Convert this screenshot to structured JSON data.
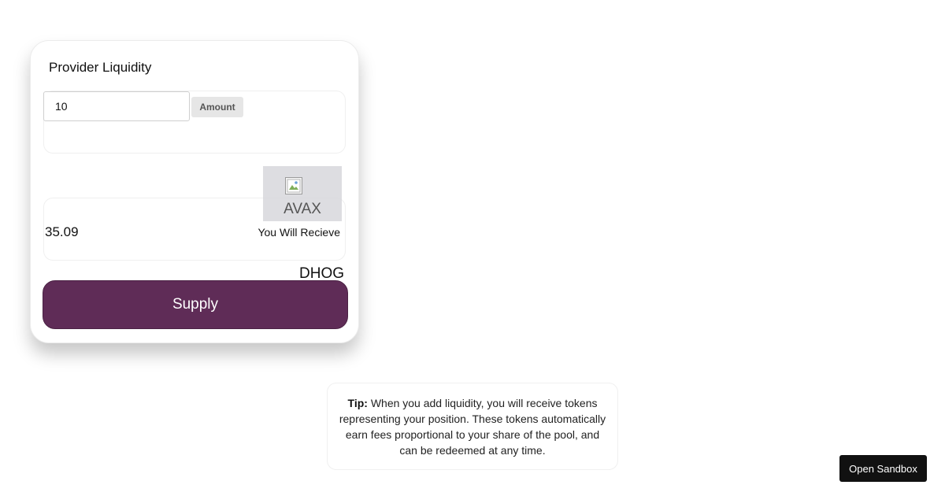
{
  "card": {
    "title": "Provider Liquidity",
    "input": {
      "value": "10",
      "badge": "Amount",
      "token_icon": "broken-image-icon",
      "token_symbol": "AVAX"
    },
    "output": {
      "value": "35.09",
      "label": "You Will Recieve",
      "token_symbol": "DHOG"
    },
    "supply_label": "Supply",
    "accent_color": "#5f2c57"
  },
  "tip": {
    "prefix": "Tip:",
    "text": "When you add liquidity, you will receive tokens representing your position. These tokens automatically earn fees proportional to your share of the pool, and can be redeemed at any time."
  },
  "sandbox_label": "Open Sandbox"
}
